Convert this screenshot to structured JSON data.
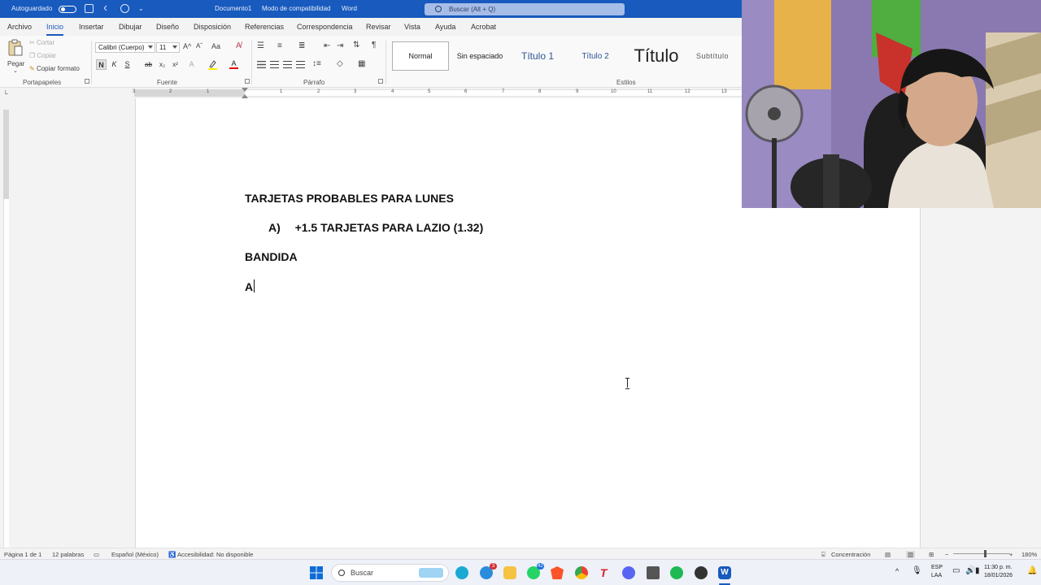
{
  "titlebar": {
    "autosave": "Autoguardado",
    "document": "Documento1",
    "mode": "Modo de compatibilidad",
    "app": "Word",
    "search_placeholder": "Buscar (Alt + Q)"
  },
  "menu": {
    "tabs": [
      "Archivo",
      "Inicio",
      "Insertar",
      "Dibujar",
      "Diseño",
      "Disposición",
      "Referencias",
      "Correspondencia",
      "Revisar",
      "Vista",
      "Ayuda",
      "Acrobat"
    ],
    "active": "Inicio"
  },
  "ribbon": {
    "clipboard": {
      "paste": "Pegar",
      "cut": "Cortar",
      "copy": "Copiar",
      "format_painter": "Copiar formato",
      "label": "Portapapeles"
    },
    "font": {
      "name": "Calibri (Cuerpo)",
      "size": "11",
      "label": "Fuente",
      "bold": "N",
      "italic": "K",
      "underline": "S",
      "strike": "ab",
      "subscript": "x₂",
      "superscript": "x²",
      "grow": "A^",
      "shrink": "Aˇ",
      "case": "Aa"
    },
    "paragraph": {
      "label": "Párrafo"
    },
    "styles": {
      "label": "Estilos",
      "items": [
        "Normal",
        "Sin espaciado",
        "Título 1",
        "Título 2",
        "Título",
        "Subtítulo"
      ]
    }
  },
  "ruler": {
    "numbers": [
      "3",
      "2",
      "1",
      "1",
      "2",
      "3",
      "4",
      "5",
      "6",
      "7",
      "8",
      "9",
      "10",
      "11",
      "12",
      "13"
    ]
  },
  "document": {
    "line1": "TARJETAS PROBABLES PARA LUNES",
    "line2_marker": "A)",
    "line2_text": "+1.5 TARJETAS PARA LAZIO (1.32)",
    "line3": "BANDIDA",
    "line4": "A"
  },
  "statusbar": {
    "page": "Página 1 de 1",
    "words": "12 palabras",
    "language": "Español (México)",
    "accessibility": "Accesibilidad: No disponible",
    "focus": "Concentración",
    "zoom": "180%"
  },
  "taskbar": {
    "search": "Buscar",
    "badges": {
      "app3": "3",
      "whatsapp": "42"
    },
    "lang_top": "ESP",
    "lang_bottom": "LAA",
    "time": "11:30 p. m.",
    "date": "18/01/2026"
  },
  "colors": {
    "accent": "#185abd",
    "ribbon_bg": "#f9f9f9"
  }
}
